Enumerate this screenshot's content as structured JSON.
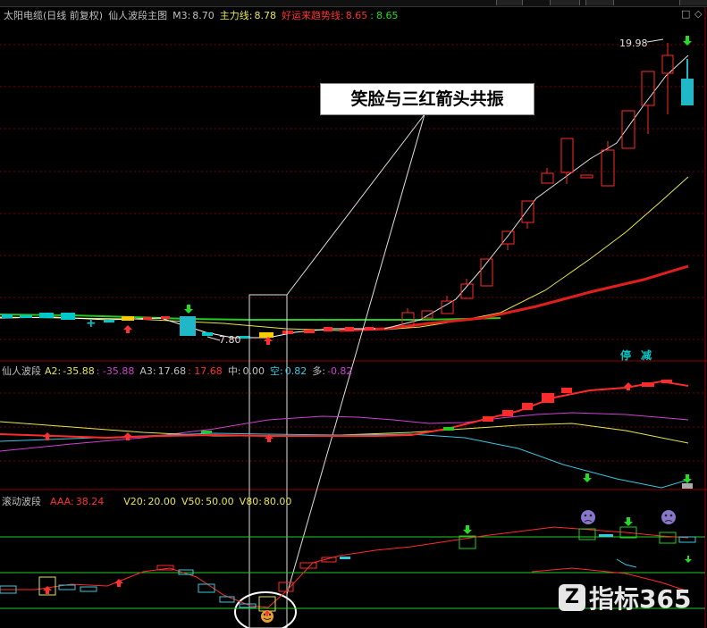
{
  "colors": {
    "background": "#000000",
    "up_candle": "#ff2a2a",
    "down_candle": "#00c8c8",
    "ma_yellow": "#e6e64a",
    "ma_red": "#e01e1e",
    "green_line": "#22cc22",
    "cyan_line": "#38c8e0",
    "magenta_line": "#d040d0",
    "grid": "#7a0000"
  },
  "main_panel": {
    "stock": "太阳电缆(日线 前复权)",
    "indicator": "仙人波段主图",
    "m3_label": "M3:",
    "m3_value": "8.70",
    "main_line_label": "主力线:",
    "main_line_value": "8.78",
    "trend_label": "好运来趋势线:",
    "trend_value_1": "8.65",
    "trend_sep": ":",
    "trend_value_2": "8.65",
    "high_price": "19.98",
    "low_price": "7.80",
    "tag_stop": "停",
    "tag_reduce": "减",
    "window_btn_1": "□",
    "window_btn_2": "◇"
  },
  "callout_text": "笑脸与三红箭头共振",
  "panel2": {
    "name": "仙人波段",
    "a2_label": "A2:",
    "a2_value": "-35.88",
    "a2_value2": ": -35.88",
    "a3_label": "A3:",
    "a3_value": "17.68",
    "a3_value2": ": 17.68",
    "mid_label": "中:",
    "mid_value": "0.00",
    "empty_label": "空:",
    "empty_value": "0.82",
    "long_label": "多:",
    "long_value": "-0.82"
  },
  "panel3": {
    "name": "滚动波段",
    "aaa_label": "AAA:",
    "aaa_value": "38.24",
    "v20_label": "V20:",
    "v20_value": "20.00",
    "v50_label": "V50:",
    "v50_value": "50.00",
    "v80_label": "V80:",
    "v80_value": "80.00"
  },
  "watermark": {
    "logo": "Z",
    "text": "指标365"
  }
}
